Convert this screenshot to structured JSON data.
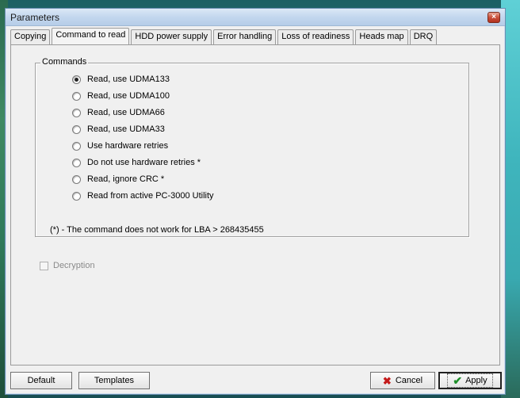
{
  "window": {
    "title": "Parameters",
    "close_symbol": "×"
  },
  "tabs": [
    {
      "label": "Copying"
    },
    {
      "label": "Command to read"
    },
    {
      "label": "HDD power supply"
    },
    {
      "label": "Error handling"
    },
    {
      "label": "Loss of readiness"
    },
    {
      "label": "Heads map"
    },
    {
      "label": "DRQ"
    }
  ],
  "active_tab": "Command to read",
  "commands": {
    "legend": "Commands",
    "options": [
      {
        "label": "Read, use UDMA133",
        "checked": true
      },
      {
        "label": "Read, use UDMA100",
        "checked": false
      },
      {
        "label": "Read, use UDMA66",
        "checked": false
      },
      {
        "label": "Read, use UDMA33",
        "checked": false
      },
      {
        "label": "Use hardware retries",
        "checked": false
      },
      {
        "label": "Do not use hardware retries *",
        "checked": false
      },
      {
        "label": "Read, ignore CRC *",
        "checked": false
      },
      {
        "label": "Read from active PC-3000 Utility",
        "checked": false
      }
    ],
    "note": "(*) - The command does not work for LBA > 268435455"
  },
  "decryption": {
    "label": "Decryption",
    "checked": false,
    "disabled": true
  },
  "buttons": {
    "default": "Default",
    "templates": "Templates",
    "cancel": "Cancel",
    "apply": "Apply"
  },
  "icons": {
    "cancel_icon": "x-icon",
    "apply_icon": "check-icon"
  },
  "colors": {
    "accent_cancel": "#c41a1a",
    "accent_apply": "#1e8f2a"
  }
}
